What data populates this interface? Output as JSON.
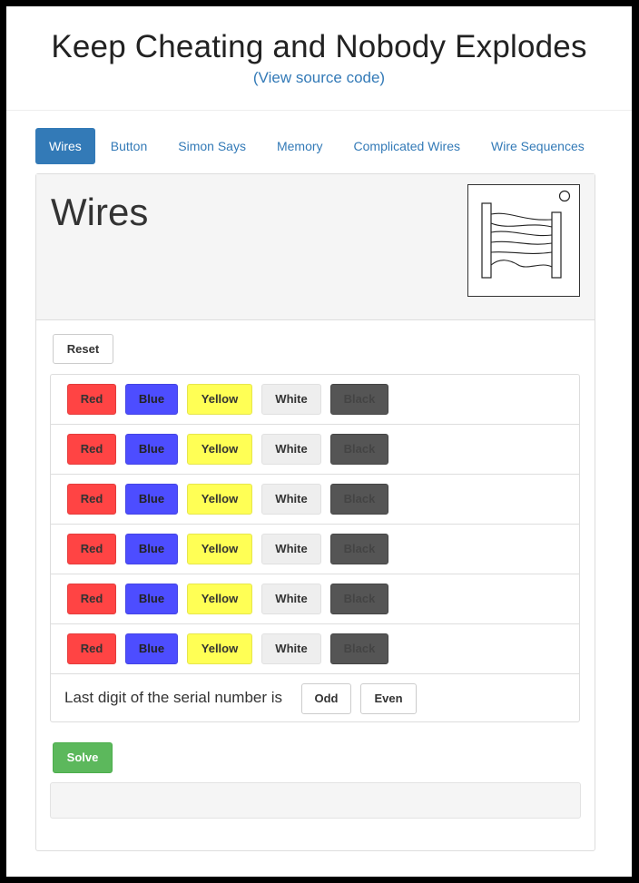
{
  "header": {
    "title": "Keep Cheating and Nobody Explodes",
    "source_link": "(View source code)"
  },
  "tabs": [
    {
      "label": "Wires",
      "active": true
    },
    {
      "label": "Button",
      "active": false
    },
    {
      "label": "Simon Says",
      "active": false
    },
    {
      "label": "Memory",
      "active": false
    },
    {
      "label": "Complicated Wires",
      "active": false
    },
    {
      "label": "Wire Sequences",
      "active": false
    }
  ],
  "module": {
    "title": "Wires",
    "image_icon": "wires-module-icon"
  },
  "controls": {
    "reset_label": "Reset",
    "solve_label": "Solve",
    "result_text": ""
  },
  "wire_colors": [
    "Red",
    "Blue",
    "Yellow",
    "White",
    "Black"
  ],
  "wire_rows": [
    {
      "buttons": [
        "Red",
        "Blue",
        "Yellow",
        "White",
        "Black"
      ]
    },
    {
      "buttons": [
        "Red",
        "Blue",
        "Yellow",
        "White",
        "Black"
      ]
    },
    {
      "buttons": [
        "Red",
        "Blue",
        "Yellow",
        "White",
        "Black"
      ]
    },
    {
      "buttons": [
        "Red",
        "Blue",
        "Yellow",
        "White",
        "Black"
      ]
    },
    {
      "buttons": [
        "Red",
        "Blue",
        "Yellow",
        "White",
        "Black"
      ]
    },
    {
      "buttons": [
        "Red",
        "Blue",
        "Yellow",
        "White",
        "Black"
      ]
    }
  ],
  "serial": {
    "label": "Last digit of the serial number is",
    "odd_label": "Odd",
    "even_label": "Even"
  },
  "colors": {
    "accent": "#337ab7",
    "red": "#ff4444",
    "blue": "#4d4dff",
    "yellow": "#ffff55",
    "white": "#eeeeee",
    "black": "#555555",
    "success": "#5cb85c"
  }
}
